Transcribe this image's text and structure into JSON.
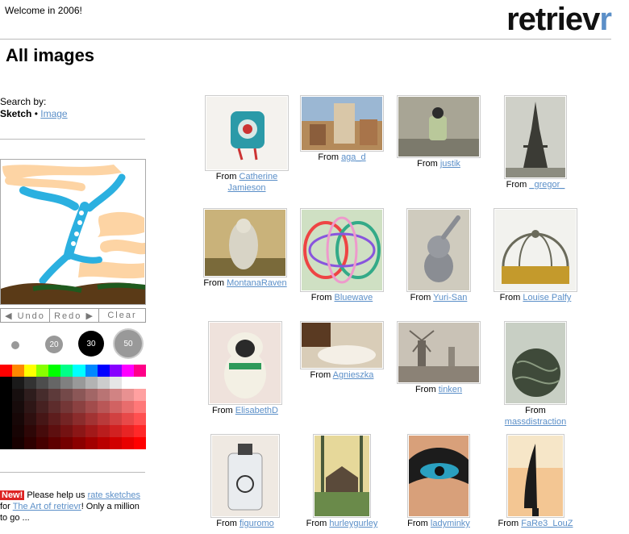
{
  "header": {
    "welcome": "Welcome in 2006!",
    "logo_main": "retriev",
    "logo_accent": "r"
  },
  "page_title": "All images",
  "search": {
    "label": "Search by:",
    "sketch": "Sketch",
    "separator": "•",
    "image": "Image"
  },
  "controls": {
    "undo": "◀ Undo",
    "redo": "Redo ▶",
    "clear": "Clear"
  },
  "brushes": {
    "small": "",
    "medium": "20",
    "large": "30",
    "xlarge": "50"
  },
  "palette": {
    "row1": [
      "#ff0000",
      "#ff8800",
      "#ffff00",
      "#88ff00",
      "#00ff00",
      "#00ff88",
      "#00ffff",
      "#0088ff",
      "#0000ff",
      "#8800ff",
      "#ff00ff",
      "#ff0088"
    ],
    "gray": [
      "#000000",
      "#1a1a1a",
      "#333333",
      "#4d4d4d",
      "#666666",
      "#808080",
      "#999999",
      "#b3b3b3",
      "#cccccc",
      "#e6e6e6",
      "#ffffff",
      "#ffffff"
    ]
  },
  "news": {
    "badge": "New!",
    "text1": "Please help us ",
    "link1": "rate sketches",
    "text2": "for ",
    "link2": "The Art of retrievr",
    "text3": "! Only a million to go ..."
  },
  "from_label": "From",
  "images": [
    {
      "author": "Catherine Jamieson"
    },
    {
      "author": "aga_d"
    },
    {
      "author": "justik"
    },
    {
      "author": "_gregor_"
    },
    {
      "author": "MontanaRaven"
    },
    {
      "author": "Bluewave"
    },
    {
      "author": "Yuri-San"
    },
    {
      "author": "Louise Palfy"
    },
    {
      "author": "ElisabethD"
    },
    {
      "author": "Agnieszka"
    },
    {
      "author": "tinken"
    },
    {
      "author": "massdistraction"
    },
    {
      "author": "figuromo"
    },
    {
      "author": "hurleygurley"
    },
    {
      "author": "ladyminky"
    },
    {
      "author": "FaRe3_LouZ"
    }
  ],
  "colors": {
    "link": "#5b8fc8",
    "badge": "#dd2222"
  }
}
